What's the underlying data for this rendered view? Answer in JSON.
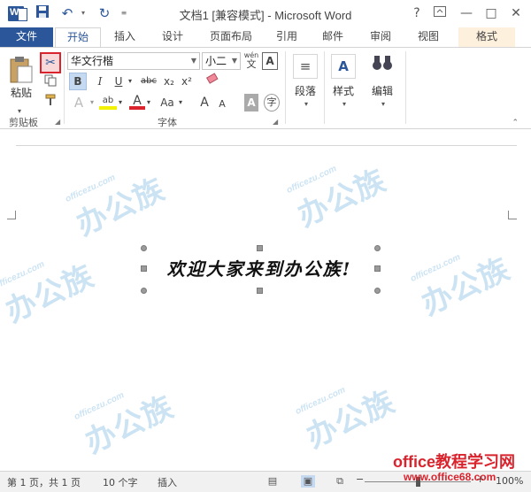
{
  "app": {
    "title": "文档1 [兼容模式] - Microsoft Word",
    "logo_letter": "W"
  },
  "qat": {
    "undo_icon": "undo-icon",
    "redo_icon": "redo-icon",
    "save_icon": "save-icon"
  },
  "window": {
    "help": "?",
    "minimize": "—",
    "restore": "□",
    "close": "✕"
  },
  "tabs": [
    {
      "label": "文件"
    },
    {
      "label": "开始"
    },
    {
      "label": "插入"
    },
    {
      "label": "设计"
    },
    {
      "label": "页面布局"
    },
    {
      "label": "引用"
    },
    {
      "label": "邮件"
    },
    {
      "label": "审阅"
    },
    {
      "label": "视图"
    },
    {
      "label": "格式"
    }
  ],
  "clipboard": {
    "paste_label": "粘贴",
    "group_label": "剪贴板"
  },
  "font": {
    "font_name": "华文行楷",
    "font_size": "小二",
    "phonetic": "wén",
    "border_char": "A",
    "bold": "B",
    "italic": "I",
    "underline": "U",
    "strike": "abc",
    "subscript": "x₂",
    "superscript": "x²",
    "highlight": "ab",
    "font_color": "A",
    "case": "Aa",
    "grow": "A",
    "shrink": "A",
    "shade": "A",
    "enclose": "字",
    "group_label": "字体"
  },
  "paragraph": {
    "label": "段落"
  },
  "styles": {
    "label": "样式"
  },
  "editing": {
    "label": "编辑"
  },
  "document": {
    "art_text": "欢迎大家来到办公族!",
    "watermark_en": "officezu.com",
    "watermark_cn": "办公族"
  },
  "status": {
    "page": "第 1 页，共 1 页",
    "words": "10 个字",
    "mode": "插入",
    "zoom": "100%"
  },
  "brand": {
    "main": "office教程学习网",
    "url": "www.office68.com"
  },
  "colors": {
    "accent": "#2b579a",
    "cut_highlight": "#d9232d",
    "context_tab": "#fdf0dc",
    "watermark": "#8fc3e6"
  }
}
